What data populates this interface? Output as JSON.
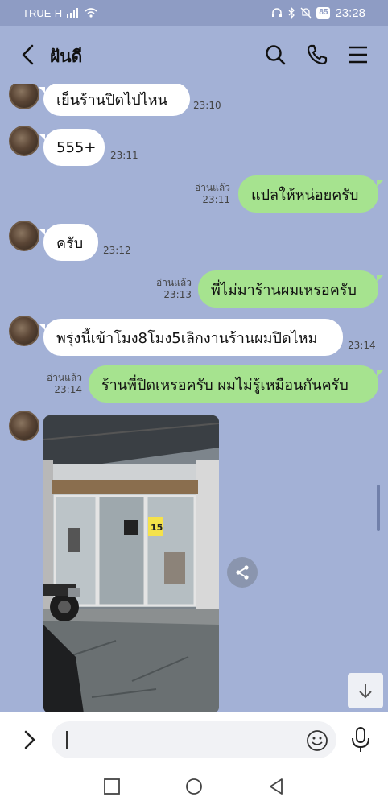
{
  "status": {
    "carrier": "TRUE-H",
    "battery": "85",
    "time": "23:28"
  },
  "header": {
    "title": "ฝันดี"
  },
  "messages": [
    {
      "text": "เย็นร้านปิดไปไหน",
      "time": "23:10",
      "direction": "in"
    },
    {
      "text": "555+",
      "time": "23:11",
      "direction": "in"
    },
    {
      "text": "แปลให้หน่อยครับ",
      "time": "23:11",
      "read": "อ่านแล้ว",
      "direction": "out"
    },
    {
      "text": "ครับ",
      "time": "23:12",
      "direction": "in"
    },
    {
      "text": "พี่ไม่มาร้านผมเหรอครับ",
      "time": "23:13",
      "read": "อ่านแล้ว",
      "direction": "out"
    },
    {
      "text": "พรุ่งนี้เข้าโมง8โมง5เลิกงานร้านผมปิดไหม",
      "time": "23:14",
      "direction": "in"
    },
    {
      "text": "ร้านพี่ปิดเหรอครับ ผมไม่รู้เหมือนกันครับ",
      "time": "23:14",
      "read": "อ่านแล้ว",
      "direction": "out"
    }
  ],
  "photo": {
    "sign_text": "15"
  },
  "colors": {
    "background": "#a3b1d6",
    "incoming": "#ffffff",
    "outgoing": "#a6e38f"
  },
  "icons": [
    "back-icon",
    "search-icon",
    "phone-icon",
    "menu-icon",
    "share-icon",
    "scroll-down-icon",
    "expand-icon",
    "emoji-icon",
    "mic-icon",
    "recent-apps-icon",
    "home-icon",
    "back-nav-icon"
  ]
}
